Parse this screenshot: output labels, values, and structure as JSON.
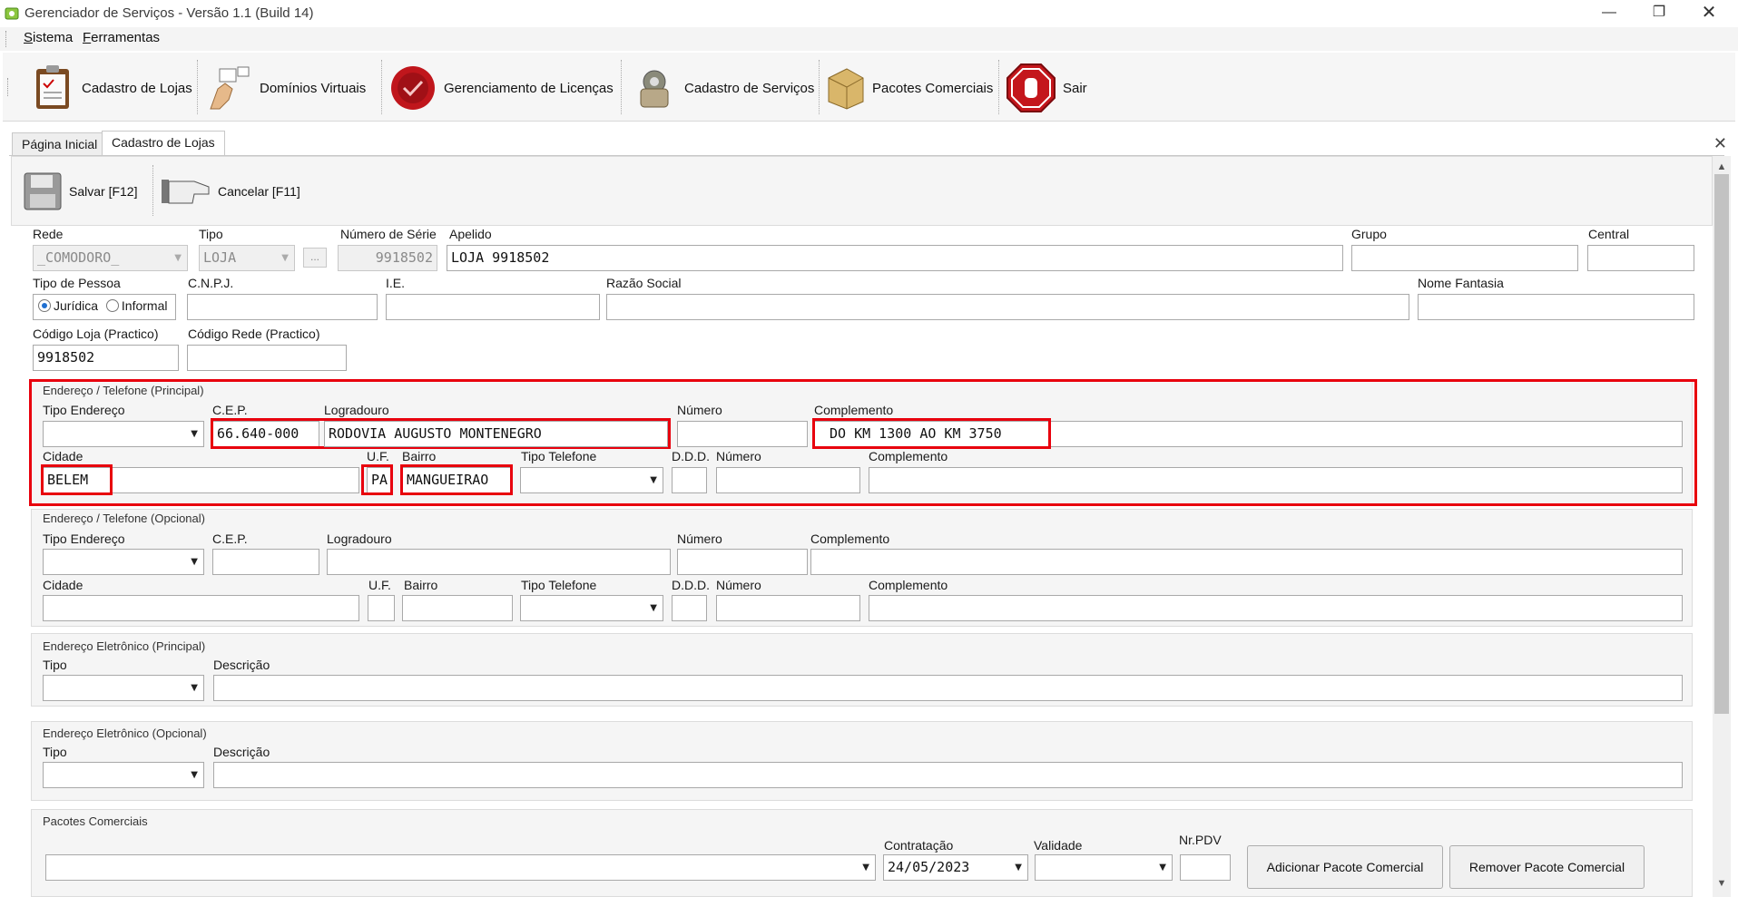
{
  "window": {
    "title": "Gerenciador de Serviços - Versão 1.1 (Build 14)"
  },
  "menu": {
    "items": [
      {
        "u": "S",
        "rest": "istema"
      },
      {
        "u": "F",
        "rest": "erramentas"
      }
    ]
  },
  "toolbar": {
    "cadastro_lojas": "Cadastro de Lojas",
    "dominios": "Domínios Virtuais",
    "licencas": "Gerenciamento de Licenças",
    "servicos": "Cadastro de Serviços",
    "pacotes": "Pacotes Comerciais",
    "sair": "Sair"
  },
  "tabs": {
    "home": "Página Inicial",
    "cadastro": "Cadastro de Lojas"
  },
  "actions": {
    "save": "Salvar [F12]",
    "cancel": "Cancelar [F11]"
  },
  "form": {
    "rede_label": "Rede",
    "rede_value": "_COMODORO_",
    "tipo_label": "Tipo",
    "tipo_value": "LOJA",
    "ellipsis": "...",
    "serie_label": "Número de Série",
    "serie_value": "9918502",
    "apelido_label": "Apelido",
    "apelido_value": "LOJA 9918502",
    "grupo_label": "Grupo",
    "central_label": "Central",
    "tipo_pessoa_label": "Tipo de Pessoa",
    "juridica": "Jurídica",
    "informal": "Informal",
    "cnpj_label": "C.N.P.J.",
    "ie_label": "I.E.",
    "razao_label": "Razão Social",
    "fantasia_label": "Nome Fantasia",
    "cod_loja_label": "Código Loja (Practico)",
    "cod_loja_value": "9918502",
    "cod_rede_label": "Código Rede (Practico)"
  },
  "address_principal": {
    "title": "Endereço / Telefone (Principal)",
    "tipo_endereco_label": "Tipo Endereço",
    "cep_label": "C.E.P.",
    "cep_value": "66.640-000",
    "logradouro_label": "Logradouro",
    "logradouro_value": "RODOVIA AUGUSTO MONTENEGRO",
    "numero_label": "Número",
    "complemento_label": "Complemento",
    "complemento_value": "DO KM 1300 AO KM 3750",
    "cidade_label": "Cidade",
    "cidade_value": "BELEM",
    "uf_label": "U.F.",
    "uf_value": "PA",
    "bairro_label": "Bairro",
    "bairro_value": "MANGUEIRAO",
    "tipo_telefone_label": "Tipo Telefone",
    "ddd_label": "D.D.D.",
    "numero2_label": "Número",
    "complemento2_label": "Complemento"
  },
  "address_opcional": {
    "title": "Endereço / Telefone (Opcional)",
    "tipo_endereco_label": "Tipo Endereço",
    "cep_label": "C.E.P.",
    "logradouro_label": "Logradouro",
    "numero_label": "Número",
    "complemento_label": "Complemento",
    "cidade_label": "Cidade",
    "uf_label": "U.F.",
    "bairro_label": "Bairro",
    "tipo_telefone_label": "Tipo Telefone",
    "ddd_label": "D.D.D.",
    "numero2_label": "Número",
    "complemento2_label": "Complemento"
  },
  "email_principal": {
    "title": "Endereço Eletrônico (Principal)",
    "tipo_label": "Tipo",
    "descricao_label": "Descrição"
  },
  "email_opcional": {
    "title": "Endereço Eletrônico (Opcional)",
    "tipo_label": "Tipo",
    "descricao_label": "Descrição"
  },
  "pacotes": {
    "title": "Pacotes Comerciais",
    "contratacao_label": "Contratação",
    "contratacao_value": "24/05/2023",
    "validade_label": "Validade",
    "nrpdv_label": "Nr.PDV",
    "add_button": "Adicionar Pacote Comercial",
    "remove_button": "Remover Pacote Comercial"
  },
  "colors": {
    "highlight": "#e8000d",
    "panel": "#f5f5f5"
  }
}
